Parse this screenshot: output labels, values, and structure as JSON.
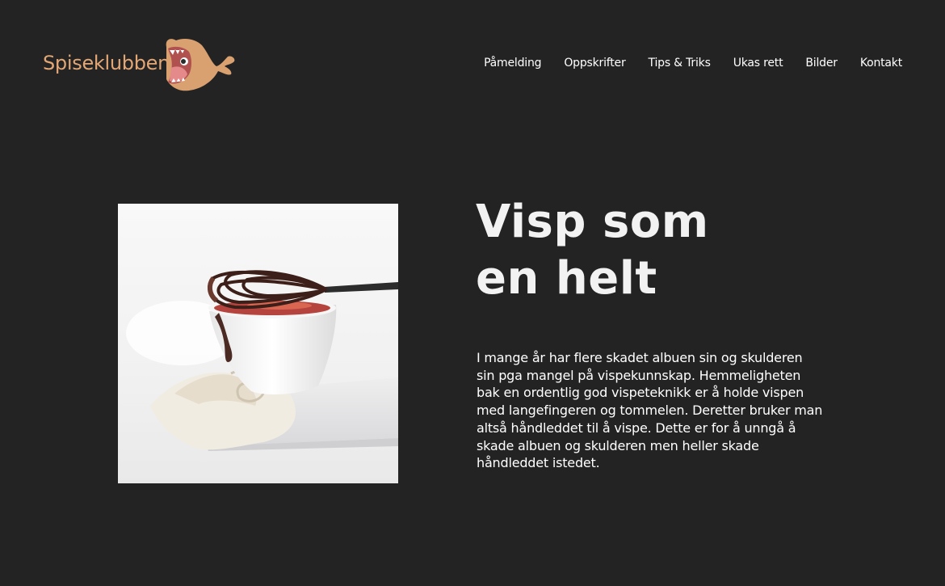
{
  "header": {
    "logo_text": "Spiseklubben",
    "logo_icon": "whale-mascot-icon",
    "nav": [
      {
        "label": "Påmelding"
      },
      {
        "label": "Oppskrifter"
      },
      {
        "label": "Tips & Triks"
      },
      {
        "label": "Ukas rett"
      },
      {
        "label": "Bilder"
      },
      {
        "label": "Kontakt"
      }
    ]
  },
  "article": {
    "title": "Visp som en helt",
    "body": "I mange år har flere skadet albuen sin og skulderen sin pga mangel på vispekunnskap. Hemmeligheten bak en ordentlig god vispeteknikk er å holde vispen med langefingeren og tommelen. Deretter bruker man altså håndleddet til å vispe. Dette er for å unngå å skade albuen og skulderen men heller skade håndleddet istedet.",
    "image": "whisk-chocolate-bowl-photo"
  },
  "colors": {
    "background": "#232323",
    "brand": "#e3a775",
    "text": "#ffffff"
  }
}
